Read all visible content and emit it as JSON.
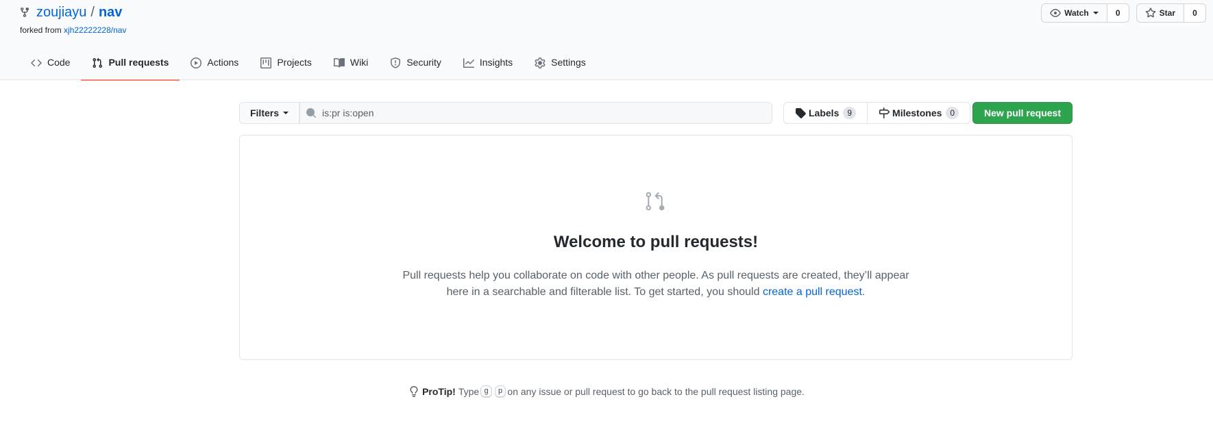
{
  "repo": {
    "owner": "zoujiayu",
    "separator": "/",
    "name": "nav",
    "forked_prefix": "forked from",
    "forked_source": "xjh22222228/nav"
  },
  "actions": {
    "watch_label": "Watch",
    "watch_count": "0",
    "star_label": "Star",
    "star_count": "0"
  },
  "nav": {
    "tabs": [
      {
        "label": "Code",
        "icon": "code-icon"
      },
      {
        "label": "Pull requests",
        "icon": "git-pull-request-icon",
        "selected": true
      },
      {
        "label": "Actions",
        "icon": "play-icon"
      },
      {
        "label": "Projects",
        "icon": "project-icon"
      },
      {
        "label": "Wiki",
        "icon": "book-icon"
      },
      {
        "label": "Security",
        "icon": "shield-icon"
      },
      {
        "label": "Insights",
        "icon": "graph-icon"
      },
      {
        "label": "Settings",
        "icon": "gear-icon"
      }
    ]
  },
  "toolbar": {
    "filters_label": "Filters",
    "search_value": "is:pr is:open",
    "labels_label": "Labels",
    "labels_count": "9",
    "milestones_label": "Milestones",
    "milestones_count": "0",
    "new_pr_label": "New pull request"
  },
  "blankslate": {
    "title": "Welcome to pull requests!",
    "text_before": "Pull requests help you collaborate on code with other people. As pull requests are created, they’ll appear here in a searchable and filterable list. To get started, you should ",
    "link_text": "create a pull request",
    "text_after": "."
  },
  "protip": {
    "label": "ProTip!",
    "text_before": "Type",
    "key1": "g",
    "key2": "p",
    "text_after": "on any issue or pull request to go back to the pull request listing page."
  },
  "colors": {
    "accent": "#0366d6",
    "primary_button": "#2ea44f",
    "selected_tab_underline": "#f9826c"
  }
}
